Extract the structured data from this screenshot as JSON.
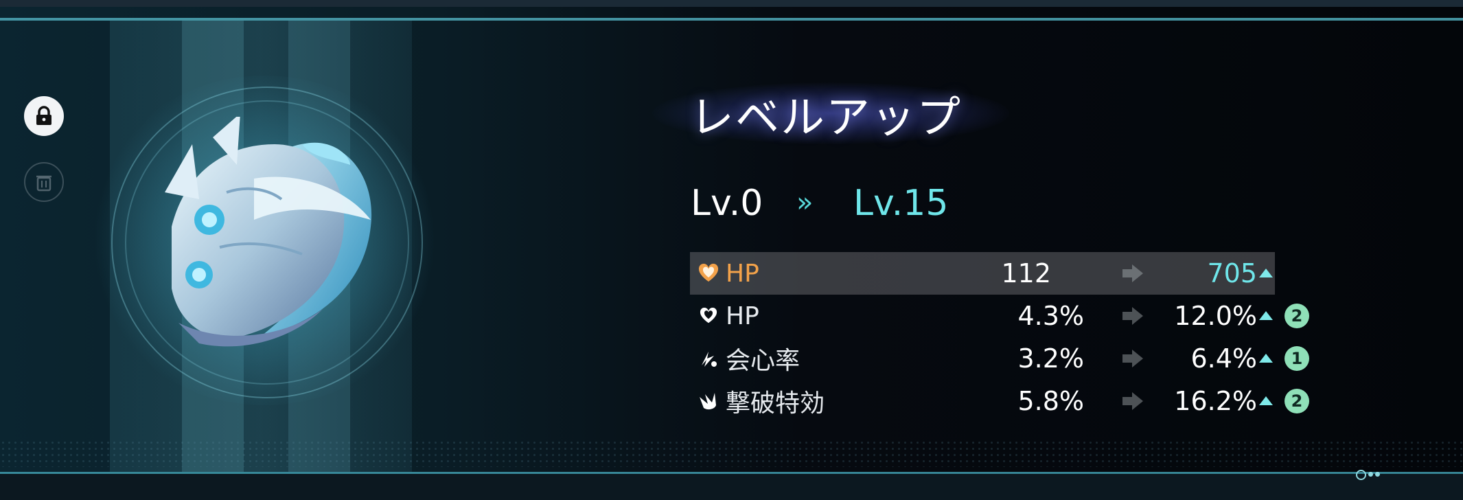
{
  "title": "レベルアップ",
  "level": {
    "from": "Lv.0",
    "arrow": "»",
    "to": "Lv.15"
  },
  "stats": [
    {
      "icon": "heart-icon",
      "name": "HP",
      "old": "112",
      "new": "705",
      "up": true,
      "badge": "",
      "highlight": true
    },
    {
      "icon": "heart-icon",
      "name": "HP",
      "old": "4.3%",
      "new": "12.0%",
      "up": true,
      "badge": "2",
      "highlight": false
    },
    {
      "icon": "crit-rate-icon",
      "name": "会心率",
      "old": "3.2%",
      "new": "6.4%",
      "up": true,
      "badge": "1",
      "highlight": false
    },
    {
      "icon": "break-effect-icon",
      "name": "撃破特効",
      "old": "5.8%",
      "new": "16.2%",
      "up": true,
      "badge": "2",
      "highlight": false
    }
  ],
  "side_buttons": {
    "lock": "lock-icon",
    "discard": "trash-icon"
  },
  "colors": {
    "accent": "#6fe6ea",
    "highlight_label": "#f3a24a",
    "badge": "#8fe0b8",
    "title_glow": "#5a64dc"
  },
  "pager": {
    "current": 1,
    "total": 3
  }
}
